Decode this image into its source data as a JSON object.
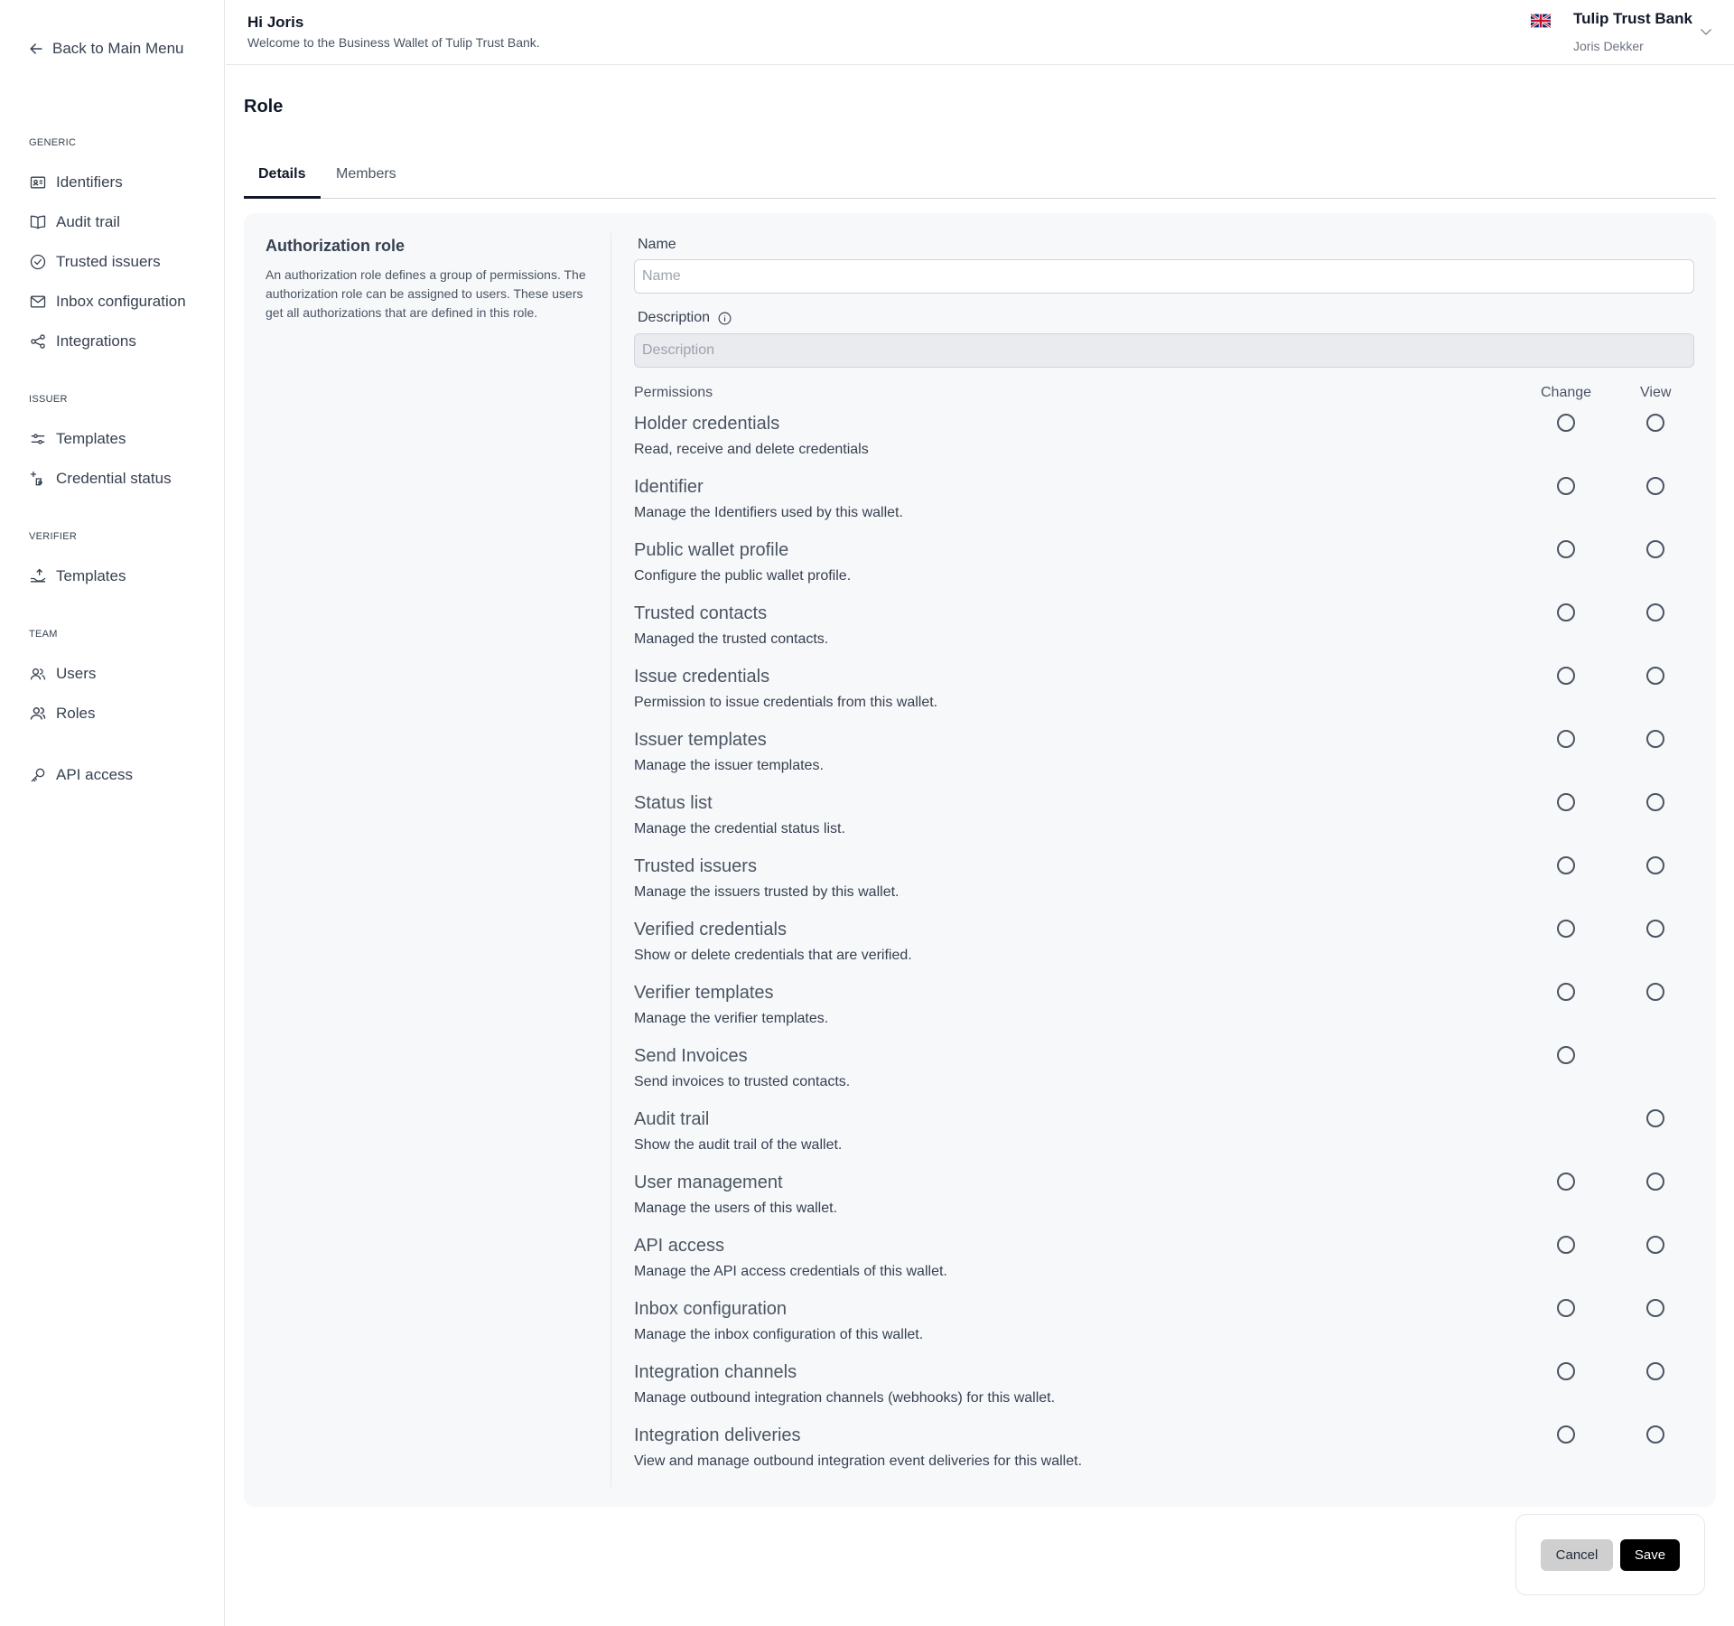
{
  "sidebar": {
    "back_label": "Back to Main Menu",
    "sections": {
      "generic": "GENERIC",
      "issuer": "ISSUER",
      "verifier": "VERIFIER",
      "team": "TEAM"
    },
    "items": {
      "identifiers": "Identifiers",
      "audit_trail": "Audit trail",
      "trusted_issuers": "Trusted issuers",
      "inbox_configuration": "Inbox configuration",
      "integrations": "Integrations",
      "issuer_templates": "Templates",
      "credential_status": "Credential status",
      "verifier_templates": "Templates",
      "users": "Users",
      "roles": "Roles",
      "api_access": "API access"
    }
  },
  "header": {
    "greeting": "Hi Joris",
    "welcome": "Welcome to the Business Wallet of Tulip Trust Bank.",
    "bank_name": "Tulip Trust Bank",
    "user_name": "Joris Dekker"
  },
  "page": {
    "title": "Role",
    "tabs": [
      "Details",
      "Members"
    ],
    "active_tab": "Details"
  },
  "form": {
    "section_title": "Authorization role",
    "section_desc": "An authorization role defines a group of permissions. The authorization role can be assigned to users. These users get all authorizations that are defined in this role.",
    "name_label": "Name",
    "name_placeholder": "Name",
    "name_value": "",
    "description_label": "Description",
    "description_placeholder": "Description",
    "description_value": "",
    "permissions_label": "Permissions",
    "change_label": "Change",
    "view_label": "View"
  },
  "permissions": [
    {
      "title": "Holder credentials",
      "desc": "Read, receive and delete credentials",
      "change": true,
      "view": true
    },
    {
      "title": "Identifier",
      "desc": "Manage the Identifiers used by this wallet.",
      "change": true,
      "view": true
    },
    {
      "title": "Public wallet profile",
      "desc": "Configure the public wallet profile.",
      "change": true,
      "view": true
    },
    {
      "title": "Trusted contacts",
      "desc": "Managed the trusted contacts.",
      "change": true,
      "view": true
    },
    {
      "title": "Issue credentials",
      "desc": "Permission to issue credentials from this wallet.",
      "change": true,
      "view": true
    },
    {
      "title": "Issuer templates",
      "desc": "Manage the issuer templates.",
      "change": true,
      "view": true
    },
    {
      "title": "Status list",
      "desc": "Manage the credential status list.",
      "change": true,
      "view": true
    },
    {
      "title": "Trusted issuers",
      "desc": "Manage the issuers trusted by this wallet.",
      "change": true,
      "view": true
    },
    {
      "title": "Verified credentials",
      "desc": "Show or delete credentials that are verified.",
      "change": true,
      "view": true
    },
    {
      "title": "Verifier templates",
      "desc": "Manage the verifier templates.",
      "change": true,
      "view": true
    },
    {
      "title": "Send Invoices",
      "desc": "Send invoices to trusted contacts.",
      "change": true,
      "view": false
    },
    {
      "title": "Audit trail",
      "desc": "Show the audit trail of the wallet.",
      "change": false,
      "view": true
    },
    {
      "title": "User management",
      "desc": "Manage the users of this wallet.",
      "change": true,
      "view": true
    },
    {
      "title": "API access",
      "desc": "Manage the API access credentials of this wallet.",
      "change": true,
      "view": true
    },
    {
      "title": "Inbox configuration",
      "desc": "Manage the inbox configuration of this wallet.",
      "change": true,
      "view": true
    },
    {
      "title": "Integration channels",
      "desc": "Manage outbound integration channels (webhooks) for this wallet.",
      "change": true,
      "view": true
    },
    {
      "title": "Integration deliveries",
      "desc": "View and manage outbound integration event deliveries for this wallet.",
      "change": true,
      "view": true
    }
  ],
  "actions": {
    "cancel": "Cancel",
    "save": "Save"
  },
  "icons": {
    "back": "arrow-left-icon",
    "identifiers": "id-card-icon",
    "audit_trail": "book-open-icon",
    "trusted_issuers": "check-circle-icon",
    "inbox_configuration": "mail-icon",
    "integrations": "share-icon",
    "issuer_templates": "sliders-icon",
    "credential_status": "status-icon",
    "verifier_templates": "hand-upload-icon",
    "users": "users-icon",
    "roles": "user-group-icon",
    "api_access": "key-icon",
    "flag": "uk-flag-icon",
    "account_menu": "chevron-down-icon",
    "description_info": "info-icon"
  }
}
